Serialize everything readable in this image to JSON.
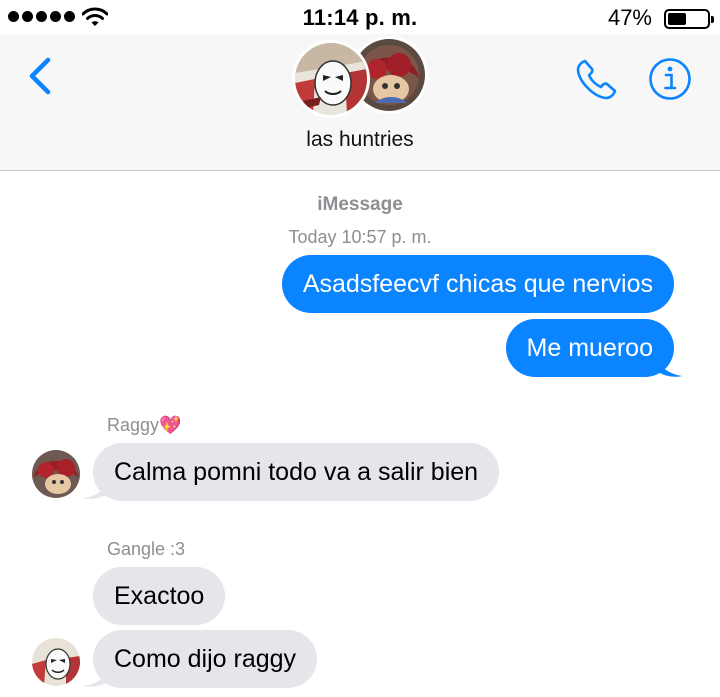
{
  "status_bar": {
    "time": "11:14 p. m.",
    "battery_percent": "47%",
    "battery_level": 0.47,
    "signal_bars": 5
  },
  "header": {
    "group_name": "las huntries",
    "icons": [
      "back-chevron-icon",
      "phone-icon",
      "info-icon"
    ]
  },
  "conversation": {
    "service": "iMessage",
    "timestamp": "Today 10:57 p. m.",
    "messages": [
      {
        "direction": "outgoing",
        "text": "Asadsfeecvf chicas que nervios"
      },
      {
        "direction": "outgoing",
        "text": "Me mueroo"
      },
      {
        "direction": "incoming",
        "sender": "Raggy💖",
        "text": "Calma pomni todo va a salir bien"
      },
      {
        "direction": "incoming",
        "sender": "Gangle :3",
        "text": "Exactoo"
      },
      {
        "direction": "incoming",
        "text": "Como dijo raggy"
      }
    ]
  },
  "colors": {
    "accent": "#0a84ff",
    "incoming_bubble": "#e5e5ea",
    "secondary_text": "#8e8e93",
    "header_bg": "#f7f7f7"
  }
}
